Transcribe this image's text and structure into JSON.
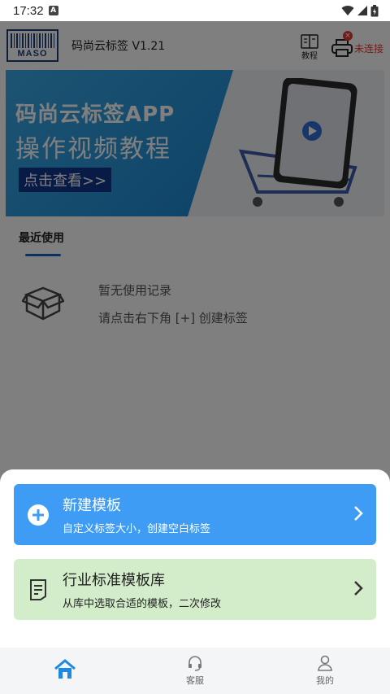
{
  "status_bar": {
    "time": "17:32",
    "notification_icon": "A"
  },
  "header": {
    "logo_text": "MASO",
    "title": "码尚云标签 V1.21",
    "tutorial_label": "教程",
    "printer_status": "未连接",
    "printer_badge": "×"
  },
  "banner": {
    "line1": "码尚云标签APP",
    "line2": "操作视频教程",
    "cta": "点击查看>>"
  },
  "recent": {
    "tab_label": "最近使用",
    "empty_line1": "暂无使用记录",
    "empty_line2": "请点击右下角 [+] 创建标签"
  },
  "sheet": {
    "new_template": {
      "title": "新建模板",
      "subtitle": "自定义标签大小，创建空白标签"
    },
    "industry_library": {
      "title": "行业标准模板库",
      "subtitle": "从库中选取合适的模板，二次修改"
    }
  },
  "bottom_nav": {
    "items": [
      {
        "label": ""
      },
      {
        "label": "客服"
      },
      {
        "label": "我的"
      }
    ]
  },
  "colors": {
    "accent": "#3f9cf5",
    "library_card": "#d3ecc9",
    "disconnected": "#e53935",
    "nav_active": "#1e88e5"
  }
}
